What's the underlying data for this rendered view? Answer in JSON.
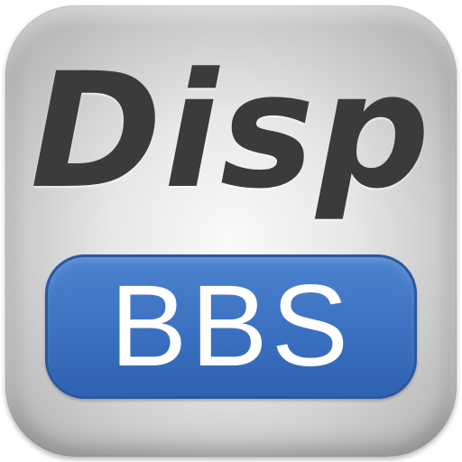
{
  "icon": {
    "title": "Disp",
    "badge_label": "BBS",
    "colors": {
      "tile": "#d9d9d9",
      "title_text": "#3b3b3b",
      "badge_fill": "#3a70bf",
      "badge_text": "#ffffff"
    }
  }
}
